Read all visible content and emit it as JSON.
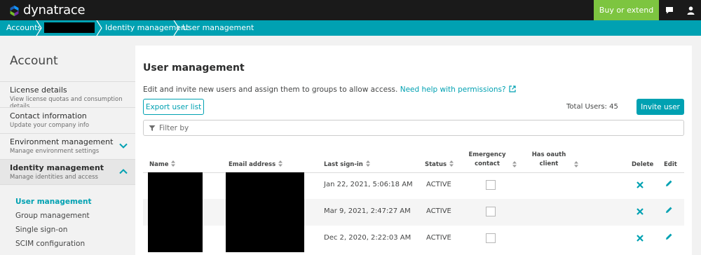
{
  "app": {
    "brand": "dynatrace",
    "buy_label": "Buy or extend",
    "icons": [
      "chat-icon",
      "user-icon"
    ],
    "colors": {
      "accent": "#00a1b2",
      "buy": "#7dc540",
      "topbar": "#1a1a1a"
    }
  },
  "breadcrumb": {
    "items": [
      "Accounts",
      "Identity management",
      "User management"
    ]
  },
  "sidebar": {
    "title": "Account",
    "sections": [
      {
        "label": "License details",
        "sub": "View license quotas and consumption details"
      },
      {
        "label": "Contact information",
        "sub": "Update your company info"
      },
      {
        "label": "Environment management",
        "sub": "Manage environment settings"
      },
      {
        "label": "Identity management",
        "sub": "Manage identities and access"
      }
    ],
    "links": [
      "User management",
      "Group management",
      "Single sign-on",
      "SCIM configuration"
    ]
  },
  "main": {
    "title": "User management",
    "description": "Edit and invite new users and assign them to groups to allow access.",
    "help_link": "Need help with permissions?",
    "export_label": "Export user list",
    "total_users": "Total Users: 45",
    "invite_label": "Invite user",
    "filter_placeholder": "Filter by",
    "columns": {
      "name": "Name",
      "email": "Email address",
      "last_signin": "Last sign-in",
      "status": "Status",
      "emergency": "Emergency contact",
      "oauth": "Has oauth client",
      "delete": "Delete",
      "edit": "Edit"
    },
    "rows": [
      {
        "last_signin": "Jan 22, 2021, 5:06:18 AM",
        "status": "ACTIVE"
      },
      {
        "last_signin": "Mar 9, 2021, 2:47:27 AM",
        "status": "ACTIVE"
      },
      {
        "last_signin": "Dec 2, 2020, 2:22:03 AM",
        "status": "ACTIVE"
      }
    ]
  }
}
